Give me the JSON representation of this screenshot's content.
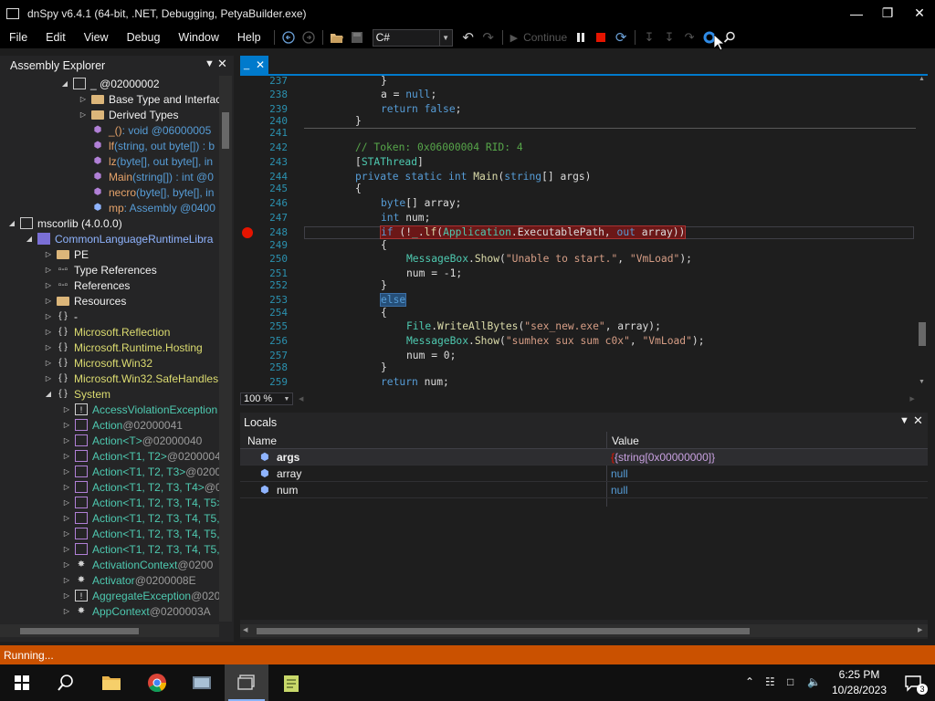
{
  "window": {
    "title": "dnSpy v6.4.1 (64-bit, .NET, Debugging, PetyaBuilder.exe)"
  },
  "menu": [
    "File",
    "Edit",
    "View",
    "Debug",
    "Window",
    "Help"
  ],
  "toolbar": {
    "language": "C#",
    "continue_label": "Continue"
  },
  "explorer": {
    "title": "Assembly Explorer",
    "nodes": [
      {
        "label": "_ @02000002"
      },
      {
        "label": "Base Type and Interfac"
      },
      {
        "label": "Derived Types"
      },
      {
        "name": "_()",
        "sig": " : void @06000005"
      },
      {
        "name": "lf",
        "sig": "(string, out byte[]) : b"
      },
      {
        "name": "lz",
        "sig": "(byte[], out byte[], in"
      },
      {
        "name": "Main",
        "sig": "(string[]) : int @0"
      },
      {
        "name": "necro",
        "sig": "(byte[], byte[], in"
      },
      {
        "name": "mp",
        "sig": " : Assembly @0400"
      },
      {
        "label": "mscorlib (4.0.0.0)"
      },
      {
        "label": "CommonLanguageRuntimeLibra"
      },
      {
        "label": "PE"
      },
      {
        "label": "Type References"
      },
      {
        "label": "References"
      },
      {
        "label": "Resources"
      },
      {
        "label": "-"
      },
      {
        "label": "Microsoft.Reflection"
      },
      {
        "label": "Microsoft.Runtime.Hosting"
      },
      {
        "label": "Microsoft.Win32"
      },
      {
        "label": "Microsoft.Win32.SafeHandles"
      },
      {
        "label": "System"
      },
      {
        "name": "AccessViolationException",
        "sig": ""
      },
      {
        "name": "Action",
        "sig": " @02000041"
      },
      {
        "name": "Action",
        "gen": "<T>",
        "sig": " @02000040"
      },
      {
        "name": "Action",
        "gen": "<T1, T2>",
        "sig": " @0200004"
      },
      {
        "name": "Action",
        "gen": "<T1, T2, T3>",
        "sig": " @0200"
      },
      {
        "name": "Action",
        "gen": "<T1, T2, T3, T4>",
        "sig": " @0"
      },
      {
        "name": "Action",
        "gen": "<T1, T2, T3, T4, T5>",
        "sig": ""
      },
      {
        "name": "Action",
        "gen": "<T1, T2, T3, T4, T5, ",
        "sig": ""
      },
      {
        "name": "Action",
        "gen": "<T1, T2, T3, T4, T5, ",
        "sig": ""
      },
      {
        "name": "Action",
        "gen": "<T1, T2, T3, T4, T5, ",
        "sig": ""
      },
      {
        "name": "ActivationContext",
        "sig": " @0200"
      },
      {
        "name": "Activator",
        "sig": " @0200008E"
      },
      {
        "name": "AggregateException",
        "sig": " @020"
      },
      {
        "name": "AppContext",
        "sig": " @0200003A"
      }
    ]
  },
  "editor": {
    "tab_label": "_",
    "line_numbers": [
      "237",
      "238",
      "239",
      "240",
      "241",
      "242",
      "243",
      "244",
      "245",
      "246",
      "247",
      "248",
      "249",
      "250",
      "251",
      "252",
      "253",
      "254",
      "255",
      "256",
      "257",
      "258",
      "259"
    ],
    "code": {
      "l237": "}",
      "l238_a": "a = ",
      "l238_b": "null",
      "l238_c": ";",
      "l239_a": "return ",
      "l239_b": "false",
      "l239_c": ";",
      "l240": "}",
      "l242": "// Token: 0x06000004 RID: 4",
      "l243_a": "[",
      "l243_b": "STAThread",
      "l243_c": "]",
      "l244_a": "private static int ",
      "l244_b": "Main",
      "l244_c": "(",
      "l244_d": "string",
      "l244_e": "[] args)",
      "l245": "{",
      "l246_a": "byte",
      "l246_b": "[] array;",
      "l247_a": "int",
      "l247_b": " num;",
      "l248_a": "if",
      "l248_b": " (!",
      "l248_c": "_",
      "l248_d": ".",
      "l248_e": "lf",
      "l248_f": "(",
      "l248_g": "Application",
      "l248_h": ".",
      "l248_i": "ExecutablePath",
      "l248_j": ", ",
      "l248_k": "out",
      "l248_l": " array))",
      "l249": "{",
      "l250_a": "MessageBox",
      "l250_b": ".",
      "l250_c": "Show",
      "l250_d": "(",
      "l250_e": "\"Unable to start.\"",
      "l250_f": ", ",
      "l250_g": "\"VmLoad\"",
      "l250_h": ");",
      "l251": "num = -1;",
      "l252": "}",
      "l253": "else",
      "l254": "{",
      "l255_a": "File",
      "l255_b": ".",
      "l255_c": "WriteAllBytes",
      "l255_d": "(",
      "l255_e": "\"sex_new.exe\"",
      "l255_f": ", array);",
      "l256_a": "MessageBox",
      "l256_b": ".",
      "l256_c": "Show",
      "l256_d": "(",
      "l256_e": "\"sumhex sux sum c0x\"",
      "l256_f": ", ",
      "l256_g": "\"VmLoad\"",
      "l256_h": ");",
      "l257": "num = 0;",
      "l258": "}",
      "l259_a": "return",
      "l259_b": " num;"
    },
    "zoom": "100 %"
  },
  "locals": {
    "title": "Locals",
    "col_name": "Name",
    "col_value": "Value",
    "rows": [
      {
        "name": "args",
        "value": "{string[0x00000000]}"
      },
      {
        "name": "array",
        "value": "null"
      },
      {
        "name": "num",
        "value": "null"
      }
    ]
  },
  "status": "Running...",
  "taskbar": {
    "time": "6:25 PM",
    "date": "10/28/2023",
    "notifications": "3"
  },
  "colors": {
    "accent": "#007acc",
    "status_running": "#ca5100",
    "breakpoint": "#e51400"
  }
}
